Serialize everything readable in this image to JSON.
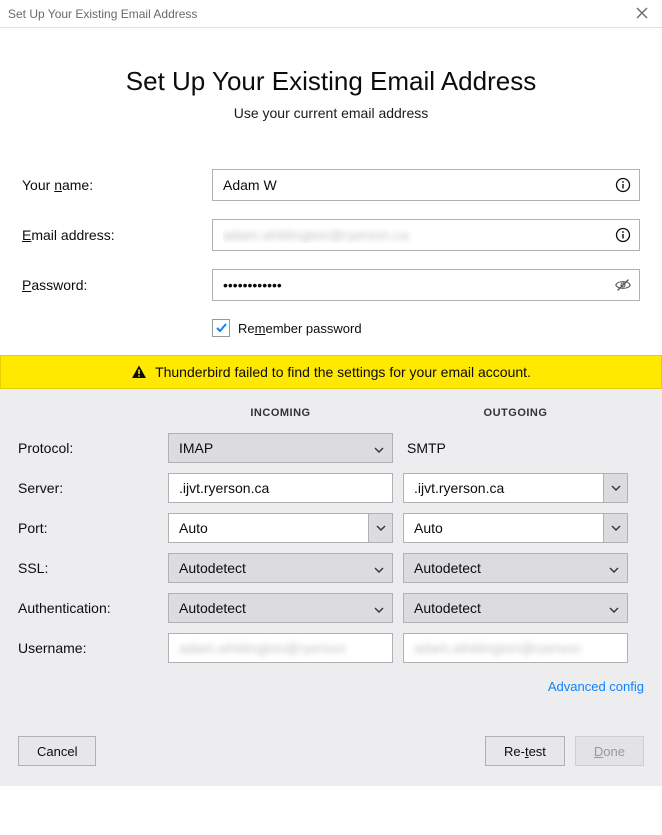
{
  "titlebar": {
    "title": "Set Up Your Existing Email Address"
  },
  "heading": "Set Up Your Existing Email Address",
  "subheading": "Use your current email address",
  "form": {
    "name_label_pre": "Your ",
    "name_label_u": "n",
    "name_label_post": "ame:",
    "name_value": "Adam W",
    "email_label_u": "E",
    "email_label_post": "mail address:",
    "email_value": "adam.whittington@ryerson.ca",
    "password_label_u": "P",
    "password_label_post": "assword:",
    "password_value": "••••••••••••",
    "remember_pre": "Re",
    "remember_u": "m",
    "remember_post": "ember password"
  },
  "warning": "Thunderbird failed to find the settings for your email account.",
  "config": {
    "incoming_header": "INCOMING",
    "outgoing_header": "OUTGOING",
    "protocol_label": "Protocol:",
    "protocol_in": "IMAP",
    "protocol_out": "SMTP",
    "server_label": "Server:",
    "server_in": ".ijvt.ryerson.ca",
    "server_out": ".ijvt.ryerson.ca",
    "port_label": "Port:",
    "port_in": "Auto",
    "port_out": "Auto",
    "ssl_label": "SSL:",
    "ssl_in": "Autodetect",
    "ssl_out": "Autodetect",
    "auth_label": "Authentication:",
    "auth_in": "Autodetect",
    "auth_out": "Autodetect",
    "username_label": "Username:",
    "username_in": "adam.whittington@ryerson",
    "username_out": "adam.whittington@ryerson",
    "advanced_link": "Advanced config"
  },
  "footer": {
    "cancel": "Cancel",
    "retest_pre": "Re-",
    "retest_u": "t",
    "retest_post": "est",
    "done_u": "D",
    "done_post": "one"
  }
}
